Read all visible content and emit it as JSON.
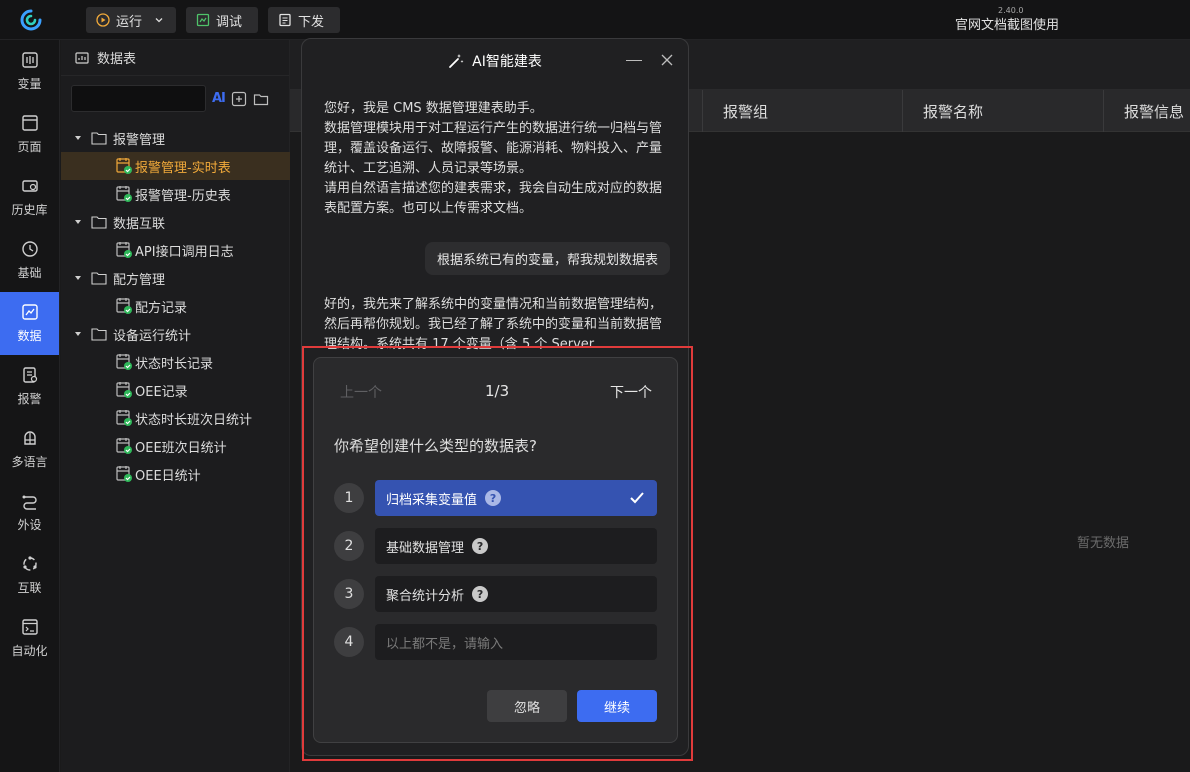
{
  "toolbar": {
    "run_label": "运行",
    "debug_label": "调试",
    "deploy_label": "下发"
  },
  "app": {
    "version": "2.40.0",
    "title": "官网文档截图使用"
  },
  "leftnav": [
    {
      "label": "变量",
      "icon": "variable-icon"
    },
    {
      "label": "页面",
      "icon": "page-icon"
    },
    {
      "label": "历史库",
      "icon": "history-icon"
    },
    {
      "label": "基础",
      "icon": "basic-icon"
    },
    {
      "label": "数据",
      "icon": "data-icon",
      "active": true
    },
    {
      "label": "报警",
      "icon": "alarm-icon"
    },
    {
      "label": "多语言",
      "icon": "language-icon"
    },
    {
      "label": "外设",
      "icon": "peripheral-icon"
    },
    {
      "label": "互联",
      "icon": "connect-icon"
    },
    {
      "label": "自动化",
      "icon": "automation-icon"
    }
  ],
  "tree": {
    "header": "数据表",
    "ai_label": "AI",
    "nodes": [
      {
        "label": "报警管理",
        "type": "folder"
      },
      {
        "label": "报警管理-实时表",
        "type": "table",
        "selected": true
      },
      {
        "label": "报警管理-历史表",
        "type": "table"
      },
      {
        "label": "数据互联",
        "type": "folder"
      },
      {
        "label": "API接口调用日志",
        "type": "table"
      },
      {
        "label": "配方管理",
        "type": "folder"
      },
      {
        "label": "配方记录",
        "type": "table"
      },
      {
        "label": "设备运行统计",
        "type": "folder"
      },
      {
        "label": "状态时长记录",
        "type": "table"
      },
      {
        "label": "OEE记录",
        "type": "table"
      },
      {
        "label": "状态时长班次日统计",
        "type": "table"
      },
      {
        "label": "OEE班次日统计",
        "type": "table"
      },
      {
        "label": "OEE日统计",
        "type": "table"
      }
    ]
  },
  "table": {
    "columns": [
      "报警组",
      "报警名称",
      "报警信息"
    ],
    "empty_text": "暂无数据"
  },
  "ai_panel": {
    "title": "AI智能建表",
    "intro": [
      "您好，我是 CMS 数据管理建表助手。",
      "数据管理模块用于对工程运行产生的数据进行统一归档与管理，覆盖设备运行、故障报警、能源消耗、物料投入、产量统计、工艺追溯、人员记录等场景。",
      "请用自然语言描述您的建表需求，我会自动生成对应的数据表配置方案。也可以上传需求文档。"
    ],
    "user_message": "根据系统已有的变量，帮我规划数据表",
    "reply": "好的，我先来了解系统中的变量情况和当前数据管理结构，然后再帮你规划。我已经了解了系统中的变量和当前数据管理结构。系统共有 17 个变量（含 5 个 Server",
    "card": {
      "prev": "上一个",
      "page": "1/3",
      "next": "下一个",
      "question": "你希望创建什么类型的数据表?",
      "options": [
        {
          "num": "1",
          "label": "归档采集变量值",
          "selected": true
        },
        {
          "num": "2",
          "label": "基础数据管理"
        },
        {
          "num": "3",
          "label": "聚合统计分析"
        }
      ],
      "other": {
        "num": "4",
        "placeholder": "以上都不是，请输入"
      },
      "ignore_label": "忽略",
      "continue_label": "继续"
    }
  },
  "colors": {
    "accent": "#3d6cf1",
    "selected_tree": "#f0a93a",
    "highlight": "#e03b3b",
    "ok": "#2fb85a"
  }
}
